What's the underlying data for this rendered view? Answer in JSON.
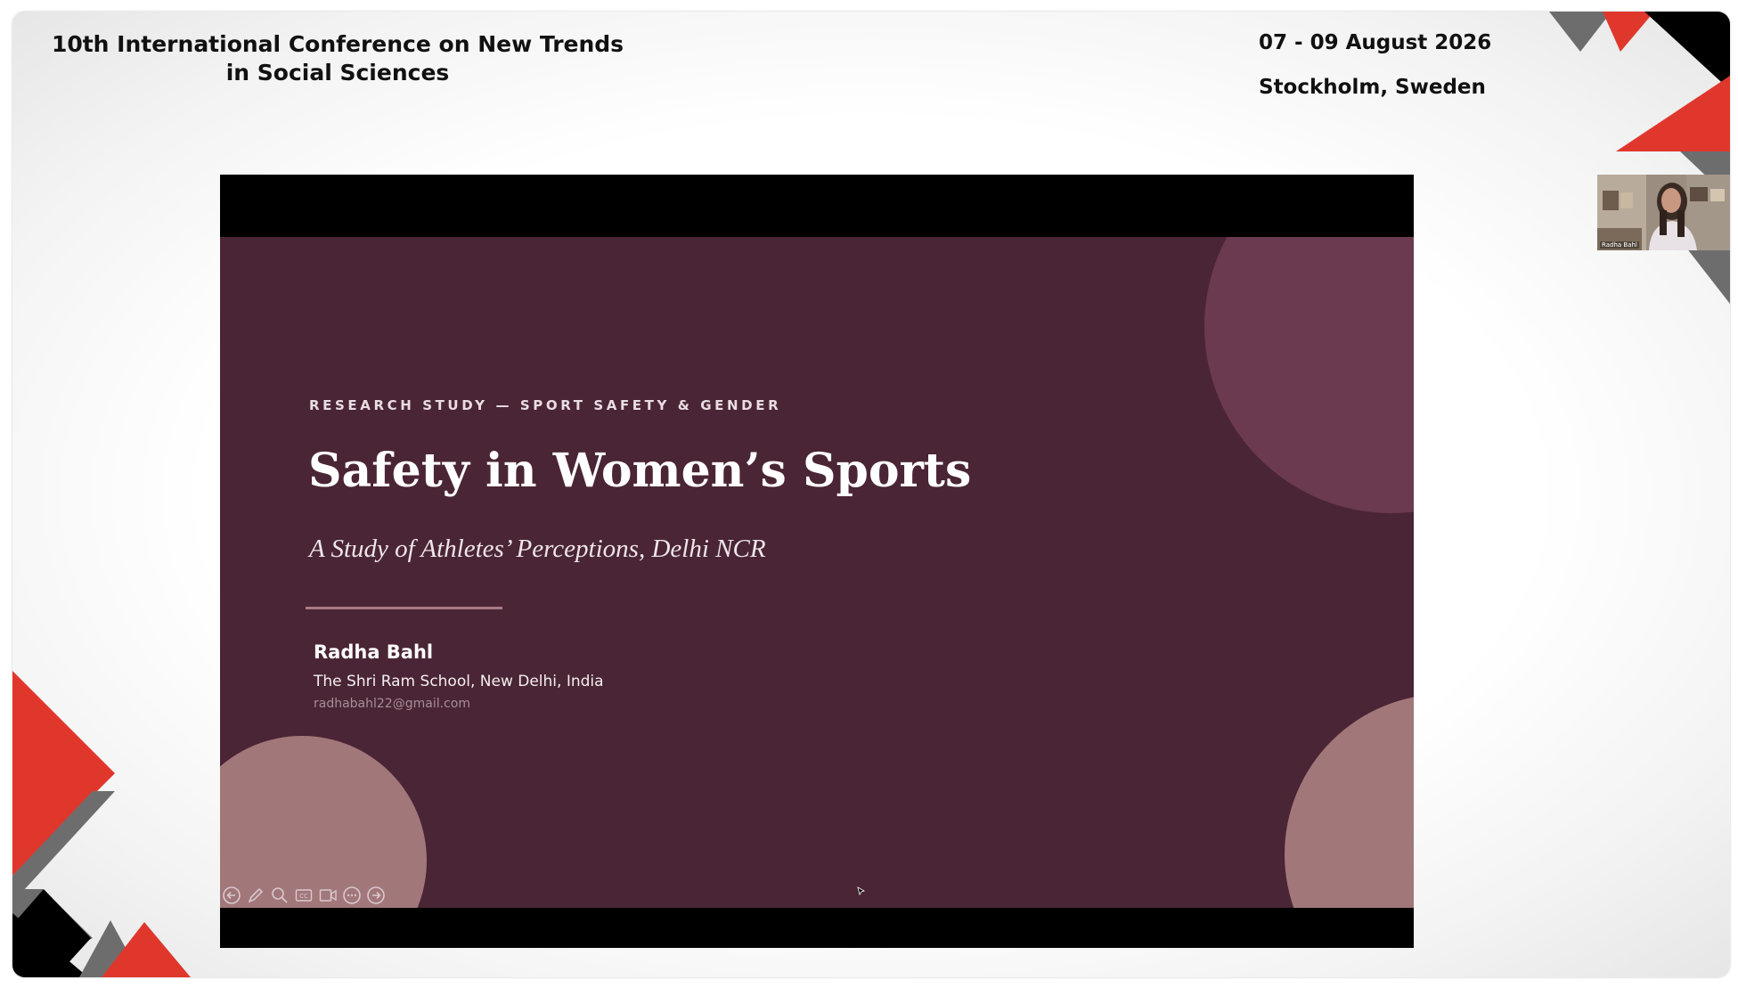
{
  "conference": {
    "title_line1": "10th International Conference on New Trends",
    "title_line2": "in Social Sciences",
    "dates": "07 - 09 August 2026",
    "location": "Stockholm, Sweden"
  },
  "colors": {
    "accent_red": "#e0372d",
    "accent_gray": "#6d6d6d",
    "accent_black": "#000000",
    "slide_background": "#4a2535"
  },
  "slide": {
    "eyebrow": "RESEARCH STUDY — SPORT SAFETY & GENDER",
    "title": "Safety in Women’s Sports",
    "subtitle": "A Study of Athletes’ Perceptions, Delhi NCR",
    "author": "Radha Bahl",
    "affiliation": "The Shri Ram School, New Delhi, India",
    "email": "radhabahl22@gmail.com"
  },
  "presenter_toolbar": {
    "icons": [
      "previous-slide-icon",
      "pen-icon",
      "zoom-icon",
      "captions-icon",
      "camera-icon",
      "more-options-icon",
      "next-slide-icon"
    ]
  },
  "participant_video": {
    "name": "Radha Bahl"
  }
}
